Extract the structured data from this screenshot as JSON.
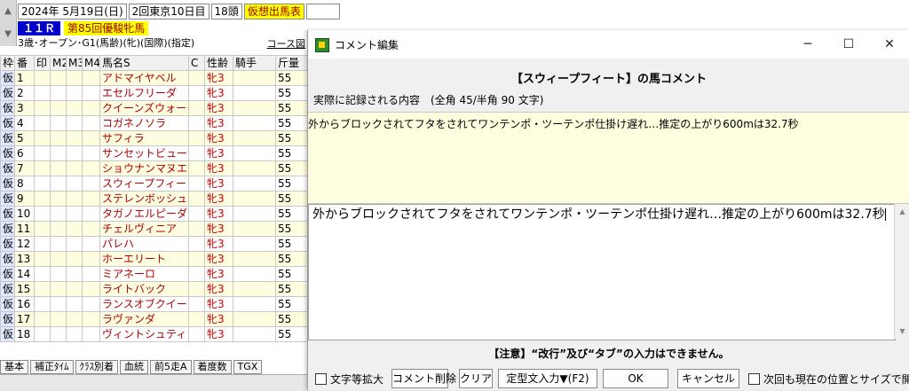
{
  "race": {
    "date": "2024年  5月19日(日)",
    "meeting": "2回東京10日目",
    "runners": "18頭",
    "card_type": "仮想出馬表",
    "race_number": "１１Ｒ",
    "race_name": "第85回優駿牝馬",
    "conditions": "3歳･オープン･G1(馬齢)(牝)(国際)(指定)",
    "course_button": "コース図"
  },
  "grid": {
    "headers": [
      "枠",
      "番",
      "印",
      "M2",
      "M3",
      "M4",
      "馬名S",
      "C",
      "性齢",
      "騎手",
      "斤量"
    ],
    "rows": [
      {
        "waku": "仮",
        "no": "1",
        "name": "アドマイヤベル",
        "sex": "牝3",
        "weight": "55"
      },
      {
        "waku": "仮",
        "no": "2",
        "name": "エセルフリーダ",
        "sex": "牝3",
        "weight": "55"
      },
      {
        "waku": "仮",
        "no": "3",
        "name": "クイーンズウォーク",
        "sex": "牝3",
        "weight": "55"
      },
      {
        "waku": "仮",
        "no": "4",
        "name": "コガネノソラ",
        "sex": "牝3",
        "weight": "55"
      },
      {
        "waku": "仮",
        "no": "5",
        "name": "サフィラ",
        "sex": "牝3",
        "weight": "55"
      },
      {
        "waku": "仮",
        "no": "6",
        "name": "サンセットビュー",
        "sex": "牝3",
        "weight": "55"
      },
      {
        "waku": "仮",
        "no": "7",
        "name": "ショウナンマヌエラ",
        "sex": "牝3",
        "weight": "55"
      },
      {
        "waku": "仮",
        "no": "8",
        "name": "スウィープフィート",
        "sex": "牝3",
        "weight": "55"
      },
      {
        "waku": "仮",
        "no": "9",
        "name": "ステレンボッシュ",
        "sex": "牝3",
        "weight": "55"
      },
      {
        "waku": "仮",
        "no": "10",
        "name": "タガノエルピーダ",
        "sex": "牝3",
        "weight": "55"
      },
      {
        "waku": "仮",
        "no": "11",
        "name": "チェルヴィニア",
        "sex": "牝3",
        "weight": "55"
      },
      {
        "waku": "仮",
        "no": "12",
        "name": "パレハ",
        "sex": "牝3",
        "weight": "55"
      },
      {
        "waku": "仮",
        "no": "13",
        "name": "ホーエリート",
        "sex": "牝3",
        "weight": "55"
      },
      {
        "waku": "仮",
        "no": "14",
        "name": "ミアネーロ",
        "sex": "牝3",
        "weight": "55"
      },
      {
        "waku": "仮",
        "no": "15",
        "name": "ライトバック",
        "sex": "牝3",
        "weight": "55"
      },
      {
        "waku": "仮",
        "no": "16",
        "name": "ランスオブクイーン",
        "sex": "牝3",
        "weight": "55"
      },
      {
        "waku": "仮",
        "no": "17",
        "name": "ラヴァンダ",
        "sex": "牝3",
        "weight": "55"
      },
      {
        "waku": "仮",
        "no": "18",
        "name": "ヴィントシュティレ",
        "sex": "牝3",
        "weight": "55"
      }
    ]
  },
  "bottom_tabs": [
    "基本",
    "補正ﾀｲﾑ",
    "ｸﾗｽ別着",
    "血統",
    "前5走A",
    "着度数",
    "TGX"
  ],
  "dialog": {
    "title": "コメント編集",
    "heading": "【スウィープフィート】の馬コメント",
    "sub": "実際に記録される内容　(全角 45/半角 90 文字)",
    "preview_text": "外からブロックされてフタをされてワンテンポ・ツーテンポ仕掛け遅れ…推定の上がり600mは32.7秒",
    "editor_text": "外からブロックされてフタをされてワンテンポ・ツーテンポ仕掛け遅れ…推定の上がり600mは32.7秒",
    "notice": "【注意】“改行”及び“タブ”の入力はできません。",
    "checkbox_enlarge": "文字等拡大",
    "btn_delete": "コメント削除",
    "btn_clear": "クリア",
    "btn_template": "定型文入力▼(F2)",
    "btn_ok": "OK",
    "btn_cancel": "キャンセル",
    "checkbox_remember": "次回も現在の位置とサイズで開く"
  }
}
